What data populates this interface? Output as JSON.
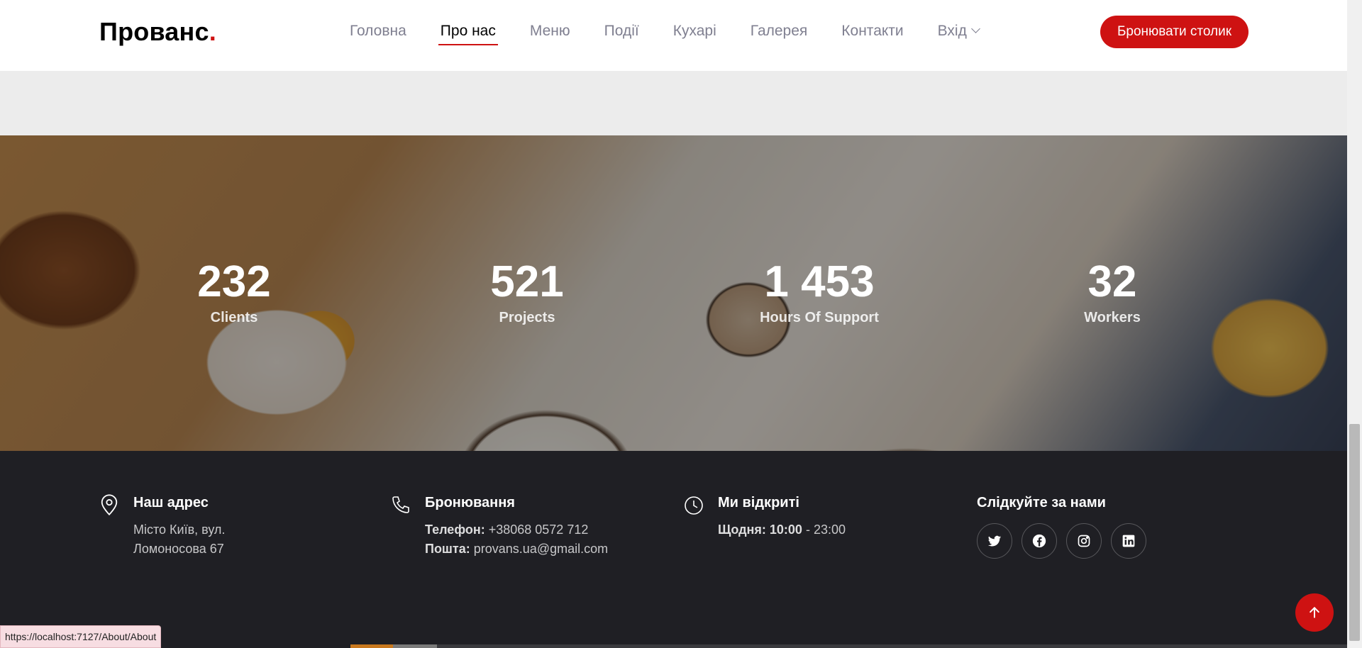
{
  "header": {
    "logo_text": "Прованс",
    "logo_dot": ".",
    "nav": [
      {
        "label": "Головна",
        "active": false
      },
      {
        "label": "Про нас",
        "active": true
      },
      {
        "label": "Меню",
        "active": false
      },
      {
        "label": "Події",
        "active": false
      },
      {
        "label": "Кухарі",
        "active": false
      },
      {
        "label": "Галерея",
        "active": false
      },
      {
        "label": "Контакти",
        "active": false
      },
      {
        "label": "Вхід",
        "active": false,
        "dropdown": true
      }
    ],
    "book_button": "Бронювати столик"
  },
  "stats": [
    {
      "value": "232",
      "label": "Clients"
    },
    {
      "value": "521",
      "label": "Projects"
    },
    {
      "value": "1 453",
      "label": "Hours Of Support"
    },
    {
      "value": "32",
      "label": "Workers"
    }
  ],
  "footer": {
    "address": {
      "title": "Наш адрес",
      "line1": "Місто Київ, вул.",
      "line2": "Ломоносова 67",
      "icon": "map-pin-icon"
    },
    "booking": {
      "title": "Бронювання",
      "phone_label": "Телефон:",
      "phone": " +38068 0572 712",
      "email_label": "Пошта:",
      "email": " provans.ua@gmail.com",
      "icon": "phone-icon"
    },
    "hours": {
      "title": "Ми відкриті",
      "days_label": "Щодня:",
      "open": " 10:00",
      "close": " - 23:00",
      "icon": "clock-icon"
    },
    "social": {
      "title": "Слідкуйте за нами",
      "icons": [
        "twitter-icon",
        "facebook-icon",
        "instagram-icon",
        "linkedin-icon"
      ]
    }
  },
  "status_bar": {
    "url": "https://localhost:7127/About/About"
  },
  "colors": {
    "accent": "#ce1212",
    "footer_bg": "#1f1f24",
    "nav_text": "#7f7f90"
  }
}
